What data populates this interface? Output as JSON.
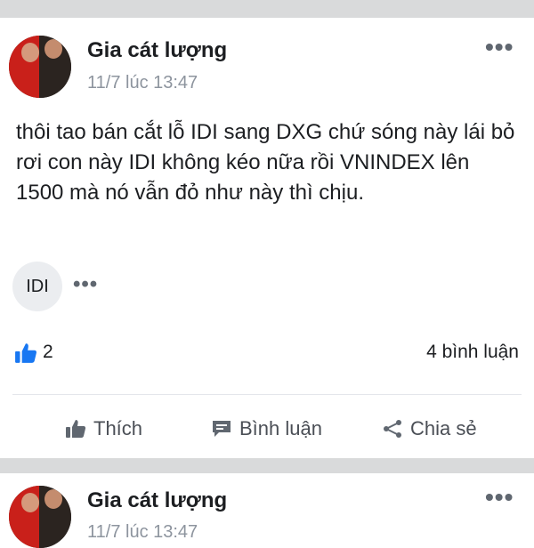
{
  "posts": [
    {
      "author": "Gia cát lượng",
      "timestamp": "11/7 lúc 13:47",
      "more_label": "•••",
      "text": "thôi tao bán cắt lỗ IDI sang DXG chứ sóng này lái bỏ rơi con này IDI không kéo nữa rồi VNINDEX lên 1500 mà nó vẫn đỏ như này thì chịu.",
      "tag": "IDI",
      "tag_more": "•••",
      "likes": "2",
      "comments": "4 bình luận",
      "actions": {
        "like": "Thích",
        "comment": "Bình luận",
        "share": "Chia sẻ"
      }
    },
    {
      "author": "Gia cát lượng",
      "timestamp": "11/7 lúc 13:47",
      "more_label": "•••"
    }
  ],
  "icons": {
    "like": "thumbs-up-icon",
    "comment": "comment-icon",
    "share": "share-icon",
    "more": "more-dots-icon"
  },
  "colors": {
    "like_blue": "#1877f2",
    "separator": "#d9dadb",
    "muted": "#8d949e"
  }
}
